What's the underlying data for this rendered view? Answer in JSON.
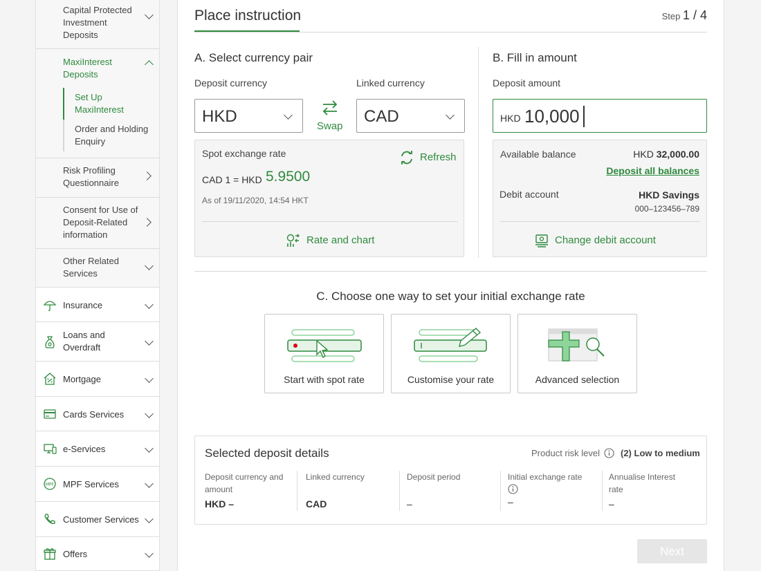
{
  "sidebar": {
    "capital_protected": "Capital Protected Investment Deposits",
    "maxiinterest": "MaxiInterest Deposits",
    "set_up": "Set Up MaxiInterest",
    "order_holding": "Order and Holding Enquiry",
    "risk_profiling": "Risk Profiling Questionnaire",
    "consent": "Consent for Use of Deposit-Related information",
    "other_related": "Other Related Services",
    "items": [
      {
        "label": "Insurance",
        "icon": "umbrella-icon"
      },
      {
        "label": "Loans and Overdraft",
        "icon": "money-bag-icon"
      },
      {
        "label": "Mortgage",
        "icon": "house-percent-icon"
      },
      {
        "label": "Cards Services",
        "icon": "credit-card-icon"
      },
      {
        "label": "e-Services",
        "icon": "computer-icon"
      },
      {
        "label": "MPF Services",
        "icon": "mpf-icon"
      },
      {
        "label": "Customer Services",
        "icon": "phone-icon"
      },
      {
        "label": "Offers",
        "icon": "gift-icon"
      }
    ]
  },
  "header": {
    "title": "Place instruction",
    "step_label": "Step",
    "step_value": "1 / 4"
  },
  "section_a": {
    "title": "A. Select currency pair",
    "deposit_label": "Deposit currency",
    "deposit_value": "HKD",
    "linked_label": "Linked currency",
    "linked_value": "CAD",
    "swap_label": "Swap",
    "spot_rate_label": "Spot exchange rate",
    "refresh_label": "Refresh",
    "rate_pair": "CAD 1 = HKD",
    "rate_value": "5.9500",
    "as_of": "As of 19/11/2020, 14:54 HKT",
    "rate_chart_label": "Rate and chart"
  },
  "section_b": {
    "title": "B. Fill in amount",
    "amount_label": "Deposit amount",
    "amount_currency": "HKD",
    "amount_value": "10,000",
    "available_label": "Available balance",
    "available_currency": "HKD",
    "available_value": "32,000.00",
    "deposit_all": "Deposit all balances",
    "debit_label": "Debit account",
    "debit_name": "HKD Savings",
    "debit_number": "000–123456–789",
    "change_debit": "Change debit account"
  },
  "section_c": {
    "title": "C. Choose one way to set your initial exchange rate",
    "options": [
      "Start with spot rate",
      "Customise your rate",
      "Advanced selection"
    ]
  },
  "details": {
    "title": "Selected deposit details",
    "risk_label": "Product risk level",
    "risk_value": "(2) Low to medium",
    "columns": [
      {
        "label": "Deposit currency and amount",
        "value": "HKD –"
      },
      {
        "label": "Linked currency",
        "value": "CAD"
      },
      {
        "label": "Deposit period",
        "value": "–"
      },
      {
        "label": "Initial exchange rate",
        "value": "–"
      },
      {
        "label": "Annualise Interest rate",
        "value": "–"
      }
    ]
  },
  "next_label": "Next",
  "colors": {
    "accent": "#2f8a3e",
    "accent_light": "#8ed49b"
  }
}
